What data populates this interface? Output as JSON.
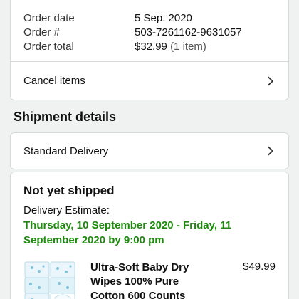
{
  "order": {
    "date_label": "Order date",
    "date_value": "5 Sep. 2020",
    "number_label": "Order #",
    "number_value": "503-7261162-9631057",
    "total_label": "Order total",
    "total_value": "$32.99",
    "total_note": "(1 item)",
    "cancel_label": "Cancel items"
  },
  "shipment": {
    "section_title": "Shipment details",
    "delivery_option": "Standard Delivery",
    "status": "Not yet shipped",
    "estimate_label": "Delivery Estimate:",
    "estimate_line1": "Thursday, 10 September 2020 - Friday, 11",
    "estimate_line2": "September 2020 by 9:00 pm",
    "item": {
      "name_line1": "Ultra-Soft Baby Dry",
      "name_line2": "Wipes 100% Pure",
      "name_line3": "Cotton 600 Counts",
      "price": "$49.99"
    }
  },
  "colors": {
    "estimate_green": "#1e8a0e",
    "card_border": "#d5d9d9",
    "page_background": "#f0f2f2"
  },
  "icons": [
    "chevron-right-icon",
    "product-thumbnail"
  ]
}
